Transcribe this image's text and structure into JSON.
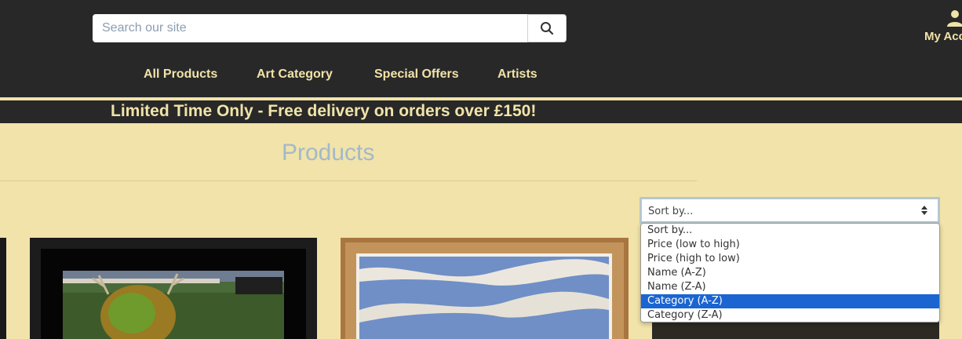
{
  "search": {
    "placeholder": "Search our site"
  },
  "account": {
    "label": "My Account"
  },
  "nav": [
    {
      "label": "All Products"
    },
    {
      "label": "Art Category"
    },
    {
      "label": "Special Offers"
    },
    {
      "label": "Artists"
    }
  ],
  "promo": {
    "text": "Limited Time Only - Free delivery on orders over £150!"
  },
  "page": {
    "title": "Products"
  },
  "sort": {
    "selected_label": "Sort by...",
    "options": [
      "Sort by...",
      "Price (low to high)",
      "Price (high to low)",
      "Name (A-Z)",
      "Name (Z-A)",
      "Category (A-Z)",
      "Category (Z-A)"
    ],
    "highlighted_option": "Category (A-Z)"
  },
  "icons": {
    "search": "search-icon",
    "account": "user-icon",
    "sort": "sort-arrows-icon"
  },
  "colors": {
    "header_bg": "#282828",
    "accent": "#f1e3a9",
    "title": "#a3b9c9",
    "highlight": "#1a65d1"
  }
}
